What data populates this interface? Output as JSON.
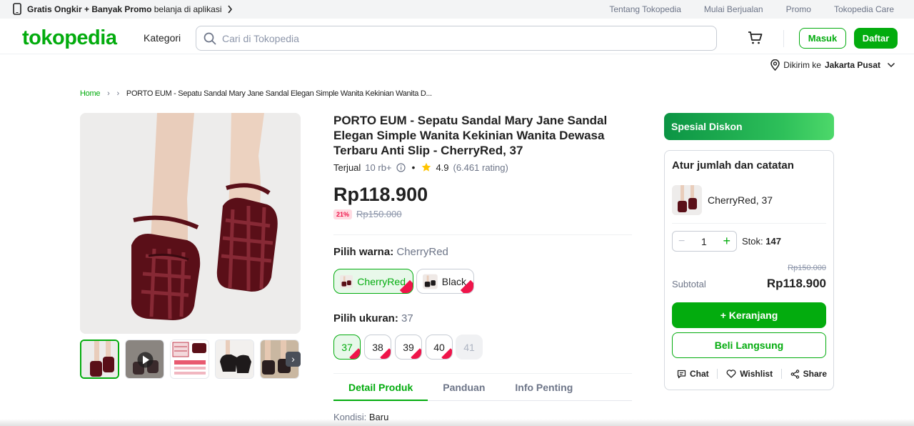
{
  "topbar": {
    "promo_bold": "Gratis Ongkir + Banyak Promo",
    "promo_rest": "belanja di aplikasi",
    "links": [
      "Tentang Tokopedia",
      "Mulai Berjualan",
      "Promo",
      "Tokopedia Care"
    ]
  },
  "header": {
    "logo": "tokopedia",
    "kategori": "Kategori",
    "search_placeholder": "Cari di Tokopedia",
    "masuk": "Masuk",
    "daftar": "Daftar",
    "ship_prefix": "Dikirim ke",
    "ship_city": "Jakarta Pusat"
  },
  "breadcrumb": {
    "home": "Home",
    "current": "PORTO EUM - Sepatu Sandal Mary Jane Sandal Elegan Simple Wanita Kekinian Wanita D..."
  },
  "product": {
    "title": "PORTO EUM - Sepatu Sandal Mary Jane Sandal Elegan Simple Wanita Kekinian Wanita Dewasa Terbaru Anti Slip - CherryRed, 37",
    "sold_label": "Terjual",
    "sold_count": "10 rb+",
    "rating": "4.9",
    "rating_count": "(6.461 rating)",
    "price": "Rp118.900",
    "discount": "21%",
    "original_price": "Rp150.000",
    "color_label": "Pilih warna:",
    "color_selected": "CherryRed",
    "colors": [
      "CherryRed",
      "Black"
    ],
    "size_label": "Pilih ukuran:",
    "size_selected": "37",
    "sizes": [
      "37",
      "38",
      "39",
      "40",
      "41"
    ],
    "tabs": [
      "Detail Produk",
      "Panduan",
      "Info Penting"
    ],
    "kondisi_label": "Kondisi:",
    "kondisi_value": "Baru"
  },
  "sidebar": {
    "spesial": "Spesial Diskon",
    "title": "Atur jumlah dan catatan",
    "variant": "CherryRed, 37",
    "qty": "1",
    "stock_label": "Stok:",
    "stock_value": "147",
    "original_price": "Rp150.000",
    "subtotal_label": "Subtotal",
    "subtotal_value": "Rp118.900",
    "add_cart": "+ Keranjang",
    "buy_now": "Beli Langsung",
    "chat": "Chat",
    "wishlist": "Wishlist",
    "share": "Share"
  },
  "colors": {
    "brand_green": "#03ac0e",
    "discount_red": "#ef144a",
    "shoe_red": "#5a0f18"
  }
}
